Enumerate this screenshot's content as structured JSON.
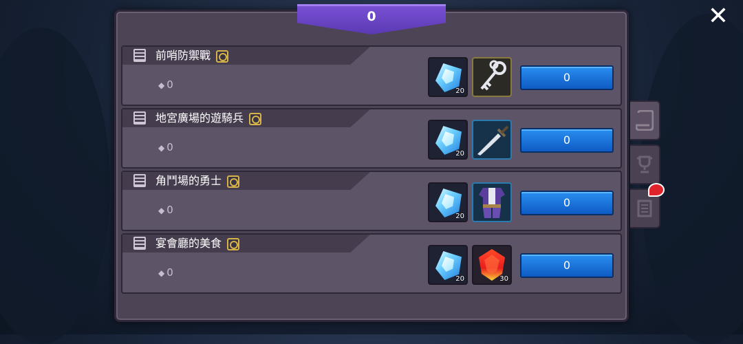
{
  "header": {
    "value": "0"
  },
  "quests": [
    {
      "title": "前哨防禦戰",
      "progress": "0",
      "gem_qty": "20",
      "item_icon": "key-icon",
      "item_qty": "",
      "button": "0"
    },
    {
      "title": "地宮廣場的遊騎兵",
      "progress": "0",
      "gem_qty": "20",
      "item_icon": "sword-icon",
      "item_qty": "",
      "button": "0"
    },
    {
      "title": "角鬥場的勇士",
      "progress": "0",
      "gem_qty": "20",
      "item_icon": "armor-icon",
      "item_qty": "",
      "button": "0"
    },
    {
      "title": "宴會廳的美食",
      "progress": "0",
      "gem_qty": "20",
      "item_icon": "ruby-icon",
      "item_qty": "30",
      "button": "0"
    }
  ],
  "side_tabs": [
    {
      "icon": "scroll-icon"
    },
    {
      "icon": "trophy-icon"
    },
    {
      "icon": "journal-icon"
    }
  ],
  "colors": {
    "header_accent": "#6a45c8",
    "button_blue": "#1a74dc",
    "panel_bg": "#4d4456",
    "notification": "#e0232b"
  }
}
